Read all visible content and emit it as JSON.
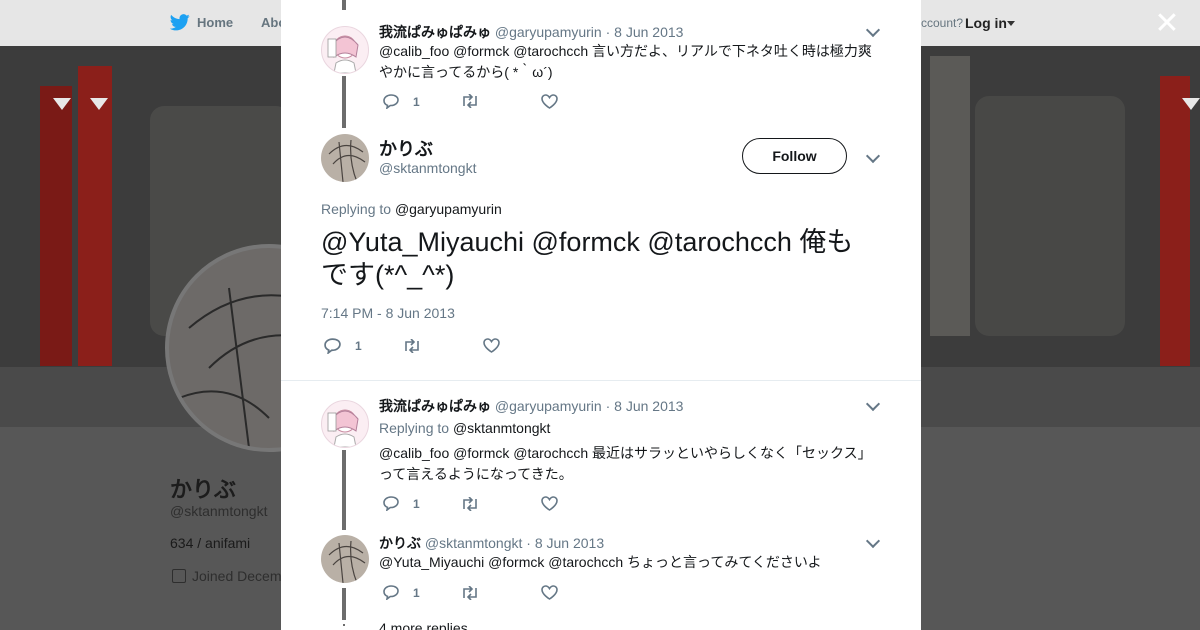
{
  "nav": {
    "home": "Home",
    "about": "Abo",
    "account": "ccount?",
    "login": "Log in"
  },
  "profile": {
    "name": "かりぶ",
    "handle": "@sktanmtongkt",
    "bio": "634 / anifami",
    "joined": "Joined Decem"
  },
  "tweets": [
    {
      "name": "我流ぱみゅぱみゅ",
      "handle": "@garyupamyurin",
      "date": "· 8 Jun 2013",
      "text_line1": "@calib_foo @formck @tarochcch 言い方だよ、リアルで下ネタ吐く時は極力爽",
      "text_line2": "やかに言ってるから( *｀ω´)",
      "replies": "1"
    },
    {
      "name": "我流ぱみゅぱみゅ",
      "handle": "@garyupamyurin",
      "date": "· 8 Jun 2013",
      "replying_label": "Replying to",
      "replying_to": "@sktanmtongkt",
      "text_line1": "@calib_foo @formck @tarochcch 最近はサラッといやらしくなく「セックス」",
      "text_line2": "って言えるようになってきた。",
      "replies": "1"
    },
    {
      "name": "かりぶ",
      "handle": "@sktanmtongkt",
      "date": "· 8 Jun 2013",
      "text_line1": "@Yuta_Miyauchi @formck @tarochcch ちょっと言ってみてくださいよ",
      "replies": "1"
    }
  ],
  "main_tweet": {
    "name": "かりぶ",
    "handle": "@sktanmtongkt",
    "follow_label": "Follow",
    "replying_label": "Replying to",
    "replying_to": "@garyupamyurin",
    "text_line1": "@Yuta_Miyauchi @formck @tarochcch 俺も",
    "text_line2": "です(*^_^*)",
    "timestamp": "7:14 PM - 8 Jun 2013",
    "replies": "1"
  },
  "more_replies": "4 more replies",
  "colors": {
    "link": "#1da1f2",
    "muted": "#657786",
    "text": "#14171a"
  }
}
